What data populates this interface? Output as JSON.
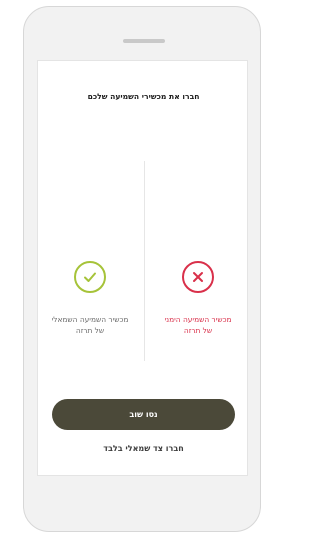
{
  "screen": {
    "title": "חברו את מכשירי השמיעה שלכם"
  },
  "right_device": {
    "status": "error",
    "icon": "x-icon",
    "color": "#d9304a",
    "label_line1": "מכשיר השמיעה הימני",
    "label_line2": "של תרזה"
  },
  "left_device": {
    "status": "connected",
    "icon": "check-icon",
    "color": "#a6c339",
    "label_line1": "מכשיר השמיעה השמאלי",
    "label_line2": "של תרזה"
  },
  "actions": {
    "retry_label": "נסו שוב",
    "left_only_label": "חברו צד שמאלי בלבד"
  },
  "colors": {
    "primary_button": "#4b4939",
    "error": "#d9304a",
    "success": "#a6c339"
  }
}
